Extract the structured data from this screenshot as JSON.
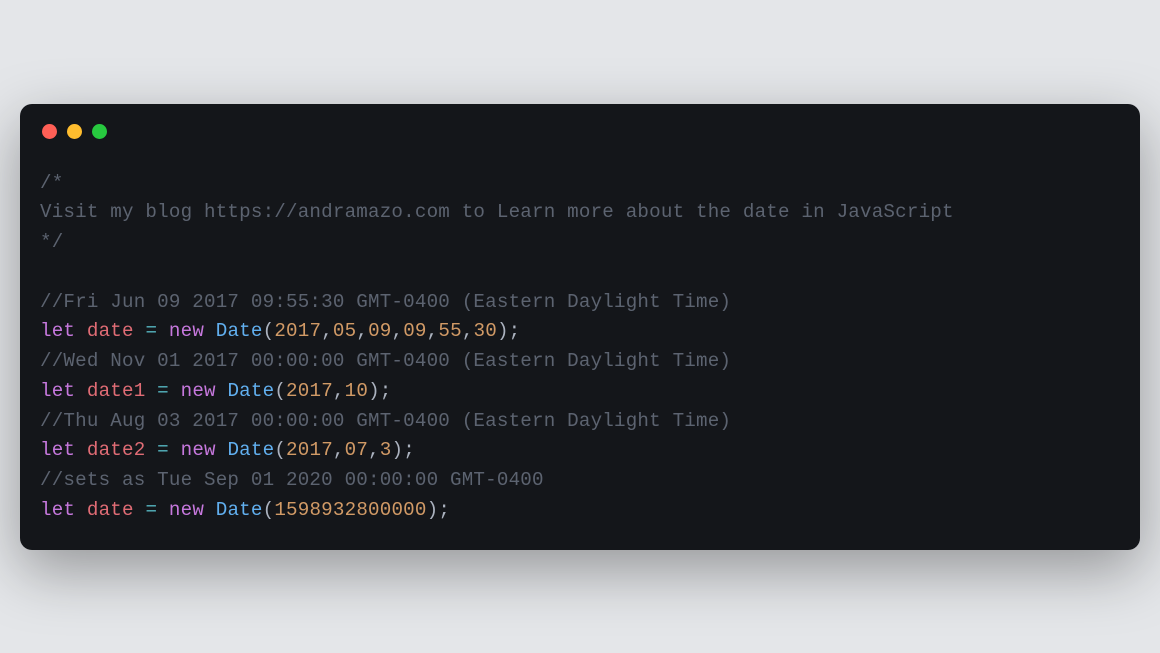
{
  "window": {
    "dots": {
      "red": "#ff5f56",
      "yellow": "#ffbd2e",
      "green": "#27c93f"
    }
  },
  "code": {
    "comment_block_l1": "/*",
    "comment_block_l2": "Visit my blog https://andramazo.com to Learn more about the date in JavaScript",
    "comment_block_l3": "*/",
    "blank": "",
    "c1": "//Fri Jun 09 2017 09:55:30 GMT-0400 (Eastern Daylight Time)",
    "l1_let": "let",
    "l1_var": " date ",
    "l1_eq": "=",
    "l1_new": " new ",
    "l1_class": "Date",
    "l1_open": "(",
    "l1_n1": "2017",
    "l1_c1": ",",
    "l1_n2": "05",
    "l1_c2": ",",
    "l1_n3": "09",
    "l1_c3": ",",
    "l1_n4": "09",
    "l1_c4": ",",
    "l1_n5": "55",
    "l1_c5": ",",
    "l1_n6": "30",
    "l1_close": ");",
    "c2": "//Wed Nov 01 2017 00:00:00 GMT-0400 (Eastern Daylight Time)",
    "l2_let": "let",
    "l2_var": " date1 ",
    "l2_eq": "=",
    "l2_new": " new ",
    "l2_class": "Date",
    "l2_open": "(",
    "l2_n1": "2017",
    "l2_c1": ",",
    "l2_n2": "10",
    "l2_close": ");",
    "c3": "//Thu Aug 03 2017 00:00:00 GMT-0400 (Eastern Daylight Time)",
    "l3_let": "let",
    "l3_var": " date2 ",
    "l3_eq": "=",
    "l3_new": " new ",
    "l3_class": "Date",
    "l3_open": "(",
    "l3_n1": "2017",
    "l3_c1": ",",
    "l3_n2": "07",
    "l3_c2": ",",
    "l3_n3": "3",
    "l3_close": ");",
    "c4": "//sets as Tue Sep 01 2020 00:00:00 GMT-0400",
    "l4_let": "let",
    "l4_var": " date ",
    "l4_eq": "=",
    "l4_new": " new ",
    "l4_class": "Date",
    "l4_open": "(",
    "l4_n1": "1598932800000",
    "l4_close": ");"
  }
}
